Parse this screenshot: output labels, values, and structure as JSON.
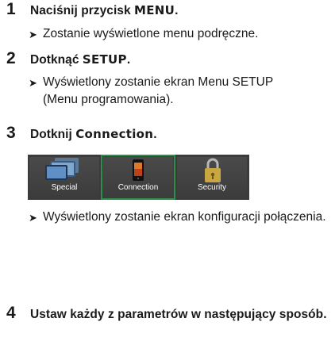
{
  "steps": [
    {
      "number": "1",
      "text_before": "Naciśnij przycisk ",
      "key": "MENU",
      "text_after": ".",
      "result": "Zostanie wyświetlone menu podręczne."
    },
    {
      "number": "2",
      "text_before": "Dotknąć ",
      "key": "SETUP",
      "text_after": ".",
      "result": "Wyświetlony zostanie ekran Menu SETUP (Menu programowania)."
    },
    {
      "number": "3",
      "text_before": "Dotknij ",
      "key": "Connection",
      "text_after": ".",
      "result": "Wyświetlony zostanie ekran konfiguracji połączenia."
    },
    {
      "number": "4",
      "text": "Ustaw każdy z parametrów w następujący sposób."
    }
  ],
  "result_arrow": "➤",
  "menu_tiles": [
    {
      "label": "Special",
      "icon": "special-screens-icon",
      "selected": false
    },
    {
      "label": "Connection",
      "icon": "smartphone-icon",
      "selected": true
    },
    {
      "label": "Security",
      "icon": "padlock-icon",
      "selected": false
    }
  ],
  "colors": {
    "panel_bg": "#3b3b3b",
    "selected_outline": "#2e8f4a"
  }
}
